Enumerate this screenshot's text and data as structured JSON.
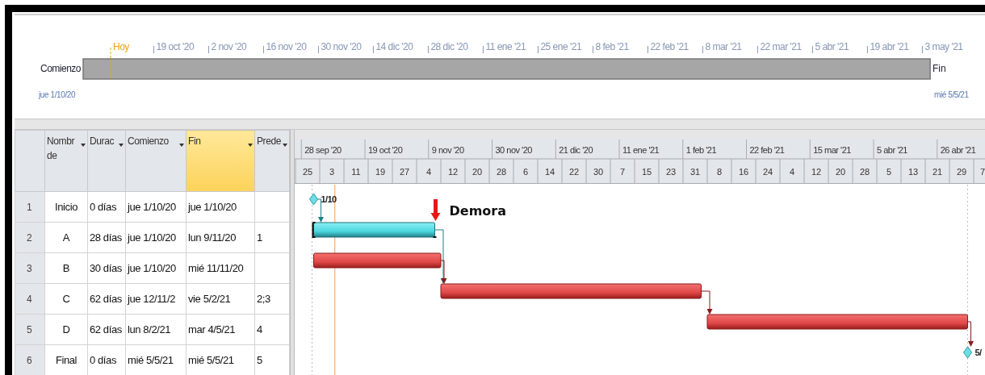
{
  "timeline": {
    "start_label": "Comienzo",
    "start_date": "jue 1/10/20",
    "finish_label": "Fin",
    "finish_date": "mié 5/5/21",
    "ticks": [
      {
        "label": "Hoy",
        "kind": "today"
      },
      {
        "label": "19 oct '20",
        "kind": "date"
      },
      {
        "label": "2 nov '20",
        "kind": "date"
      },
      {
        "label": "16 nov '20",
        "kind": "date"
      },
      {
        "label": "30 nov '20",
        "kind": "date"
      },
      {
        "label": "14 dic '20",
        "kind": "date"
      },
      {
        "label": "28 dic '20",
        "kind": "date"
      },
      {
        "label": "11 ene '21",
        "kind": "date"
      },
      {
        "label": "25 ene '21",
        "kind": "date"
      },
      {
        "label": "8 feb '21",
        "kind": "date"
      },
      {
        "label": "22 feb '21",
        "kind": "date"
      },
      {
        "label": "8 mar '21",
        "kind": "date"
      },
      {
        "label": "22 mar '21",
        "kind": "date"
      },
      {
        "label": "5 abr '21",
        "kind": "date"
      },
      {
        "label": "19 abr '21",
        "kind": "date"
      },
      {
        "label": "3 may '21",
        "kind": "date"
      }
    ]
  },
  "table": {
    "columns": [
      {
        "label": "Nombr de",
        "selected": false
      },
      {
        "label": "Durac",
        "selected": false
      },
      {
        "label": "Comienzo",
        "selected": false
      },
      {
        "label": "Fin",
        "selected": true
      },
      {
        "label": "Prede",
        "selected": false
      }
    ],
    "rows": [
      {
        "id": "1",
        "name": "Inicio",
        "duration": "0 días",
        "start": "jue 1/10/20",
        "finish": "jue 1/10/20",
        "kind": "milestone",
        "bar_label": "1/10"
      },
      {
        "id": "2",
        "name": "A",
        "duration": "28 días",
        "start": "jue 1/10/20",
        "finish": "lun 9/11/20",
        "predecessors": "1",
        "kind": "task",
        "critical": false,
        "annotation": "Demora"
      },
      {
        "id": "3",
        "name": "B",
        "duration": "30 días",
        "start": "jue 1/10/20",
        "finish": "mié 11/11/20",
        "kind": "task",
        "critical": true
      },
      {
        "id": "4",
        "name": "C",
        "duration": "62 días",
        "start": "jue 12/11/2",
        "finish": "vie 5/2/21",
        "predecessors": "2;3",
        "kind": "task",
        "critical": true
      },
      {
        "id": "5",
        "name": "D",
        "duration": "62 días",
        "start": "lun 8/2/21",
        "finish": "mar 4/5/21",
        "predecessors": "4",
        "kind": "task",
        "critical": true
      },
      {
        "id": "6",
        "name": "Final",
        "duration": "0 días",
        "start": "mié 5/5/21",
        "finish": "mié 5/5/21",
        "predecessors": "5",
        "kind": "milestone",
        "bar_label": "5/"
      }
    ]
  },
  "gantt": {
    "major_scale": [
      "28 sep '20",
      "19 oct '20",
      "9 nov '20",
      "30 nov '20",
      "21 dic '20",
      "11 ene '21",
      "1 feb '21",
      "22 feb '21",
      "15 mar '21",
      "5 abr '21",
      "26 abr '21"
    ],
    "minor_scale": [
      "25",
      "3",
      "11",
      "19",
      "27",
      "4",
      "12",
      "20",
      "28",
      "6",
      "14",
      "22",
      "30",
      "7",
      "15",
      "23",
      "31",
      "8",
      "16",
      "24",
      "4",
      "12",
      "20",
      "28",
      "5",
      "13",
      "21",
      "29",
      "7"
    ]
  }
}
